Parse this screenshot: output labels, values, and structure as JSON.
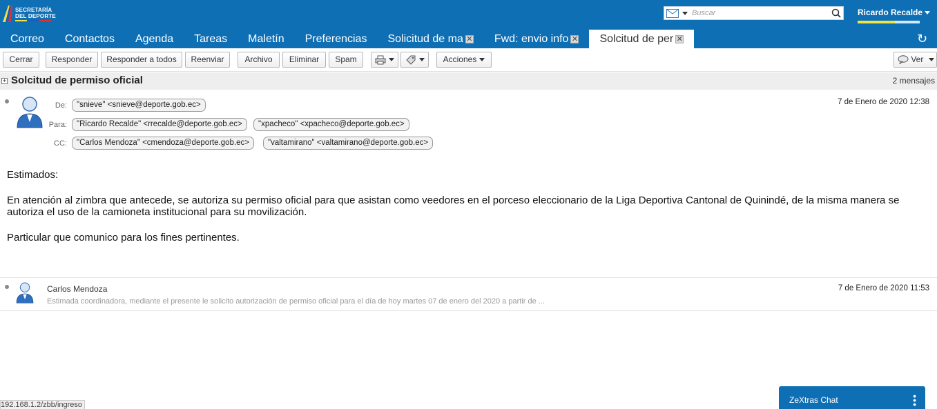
{
  "header": {
    "logo_line1": "SECRETARÍA",
    "logo_line2": "DEL DEPORTE",
    "search_placeholder": "Buscar",
    "user_name": "Ricardo Recalde",
    "accent_color": "#0f6fb4"
  },
  "tabs": [
    {
      "label": "Correo",
      "active": false,
      "closable": false
    },
    {
      "label": "Contactos",
      "active": false,
      "closable": false
    },
    {
      "label": "Agenda",
      "active": false,
      "closable": false
    },
    {
      "label": "Tareas",
      "active": false,
      "closable": false
    },
    {
      "label": "Maletín",
      "active": false,
      "closable": false
    },
    {
      "label": "Preferencias",
      "active": false,
      "closable": false
    },
    {
      "label": "Solicitud de ma",
      "active": false,
      "closable": true
    },
    {
      "label": "Fwd: envio info",
      "active": false,
      "closable": true
    },
    {
      "label": "Solcitud de per",
      "active": true,
      "closable": true
    }
  ],
  "toolbar": {
    "close": "Cerrar",
    "reply": "Responder",
    "reply_all": "Responder a todos",
    "forward": "Reenviar",
    "archive": "Archivo",
    "delete": "Eliminar",
    "spam": "Spam",
    "actions": "Acciones",
    "view": "Ver"
  },
  "conversation": {
    "title": "Solcitud de permiso oficial",
    "count": "2 mensajes"
  },
  "message": {
    "from_label": "De:",
    "to_label": "Para:",
    "cc_label": "CC:",
    "from": "\"snieve\" <snieve@deporte.gob.ec>",
    "to": [
      "\"Ricardo Recalde\" <rrecalde@deporte.gob.ec>",
      "\"xpacheco\" <xpacheco@deporte.gob.ec>"
    ],
    "cc": [
      "\"Carlos Mendoza\" <cmendoza@deporte.gob.ec>",
      "\"valtamirano\" <valtamirano@deporte.gob.ec>"
    ],
    "date": "7 de Enero de 2020 12:38",
    "body": {
      "greeting": "Estimados:",
      "paragraph1": "En atención al zimbra que antecede, se autoriza su permiso oficial para que asistan como veedores en el porceso eleccionario de la Liga Deportiva Cantonal de Quinindé, de la misma manera se autoriza el uso de la camioneta institucional para su movilización.",
      "paragraph2": "Particular que comunico para los fines pertinentes."
    }
  },
  "collapsed_message": {
    "from": "Carlos Mendoza",
    "date": "7 de Enero de 2020 11:53",
    "snippet": "Estimada coordinadora, mediante el presente le solicito autorización de permiso oficial para el día de hoy martes 07 de enero del 2020 a partir de ..."
  },
  "status_url": "192.168.1.2/zbb/ingreso",
  "chat": {
    "title": "ZeXtras Chat"
  }
}
